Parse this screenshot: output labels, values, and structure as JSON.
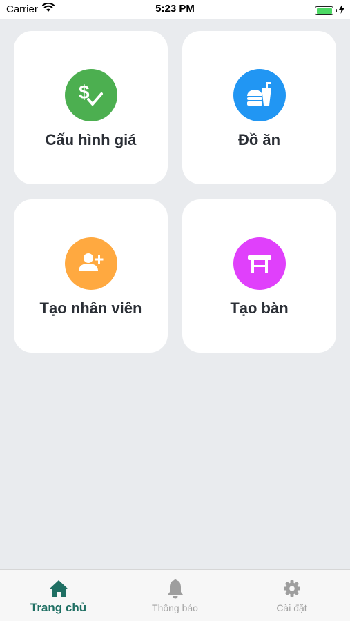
{
  "status_bar": {
    "carrier": "Carrier",
    "time": "5:23 PM"
  },
  "tiles": [
    {
      "label": "Cấu hình giá",
      "icon": "price-config-icon",
      "color": "#4caf50"
    },
    {
      "label": "Đồ ăn",
      "icon": "food-drink-icon",
      "color": "#2196f3"
    },
    {
      "label": "Tạo nhân viên",
      "icon": "add-user-icon",
      "color": "#ffa940"
    },
    {
      "label": "Tạo bàn",
      "icon": "table-icon",
      "color": "#e040fb"
    }
  ],
  "tabbar": {
    "active_color": "#1f6f63",
    "inactive_color": "#a3a3a3",
    "items": [
      {
        "label": "Trang chủ",
        "icon": "home-icon",
        "active": true
      },
      {
        "label": "Thông báo",
        "icon": "bell-icon",
        "active": false
      },
      {
        "label": "Cài đặt",
        "icon": "gear-icon",
        "active": false
      }
    ]
  }
}
